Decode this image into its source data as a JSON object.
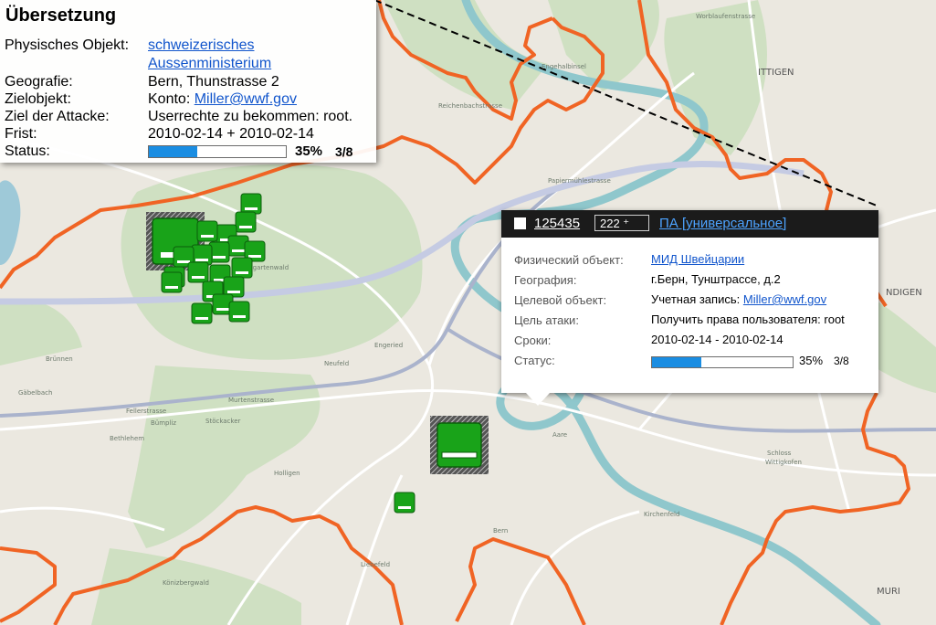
{
  "translation": {
    "title": "Übersetzung",
    "physical_label": "Physisches Objekt:",
    "physical_link_line1": "schweizerisches",
    "physical_link_line2": "Aussenministerium",
    "geo_label": "Geografie:",
    "geo_value": "Bern, Thunstrasse 2",
    "target_label": "Zielobjekt:",
    "target_prefix": "Konto:",
    "target_link": "Miller@wwf.gov",
    "goal_label": "Ziel der Attacke:",
    "goal_value": "Userrechte zu bekommen: root.",
    "deadline_label": "Frist:",
    "deadline_value": "2010-02-14 + 2010-02-14",
    "status_label": "Status:",
    "status_percent": "35%",
    "status_count": "3/8",
    "progress": 0.35
  },
  "popup": {
    "id": "125435",
    "count_badge": "222 ⁺",
    "type_link": "ПА [универсальное]",
    "phys_label": "Физический объект:",
    "phys_link": "МИД Швейцарии",
    "geo_label": "География:",
    "geo_value": "г.Берн, Тунштрассе, д.2",
    "target_label": "Целевой объект:",
    "target_prefix": "Учетная запись:",
    "target_link": "Miller@wwf.gov",
    "goal_label": "Цель атаки:",
    "goal_value": "Получить права пользователя: root",
    "deadline_label": "Сроки:",
    "deadline_value": "2010-02-14 - 2010-02-14",
    "status_label": "Статус:",
    "status_percent": "35%",
    "status_count": "3/8",
    "progress": 0.35
  },
  "map": {
    "labels": {
      "ittigen": "ITTIGEN",
      "muri": "MURI",
      "bremgartenwald": "Bremgartenwald",
      "schloss": "Schloss",
      "wittigkofen": "Wittigkofen",
      "engehalbinsel": "Engehalbinsel",
      "gaebelbach": "Gäbelbach",
      "bethlehem": "Bethlehem",
      "buempliz": "Bümpliz",
      "neufeld": "Neufeld",
      "engeried": "Engeried",
      "kuenizbergwald": "Könizbergwald",
      "liebefeld": "Liebefeld",
      "aare": "Aare",
      "bern": "Bern",
      "ndigen": "NDIGEN",
      "papiermuehle": "Papiermühlestrasse",
      "worblaufen": "Worblaufenstrasse",
      "reichenbach": "Reichenbachstrasse",
      "kirchenfeld": "Kirchenfeld",
      "stoeckacker": "Stöckacker",
      "fellerstrasse": "Fellerstrasse",
      "murtenstrasse": "Murtenstrasse",
      "bruennen": "Brünnen",
      "holligen": "Holligen"
    },
    "colors": {
      "boundary": "#f06424",
      "node": "#19a319",
      "river": "#8fc7cc",
      "forest": "#cfe0c2"
    }
  }
}
